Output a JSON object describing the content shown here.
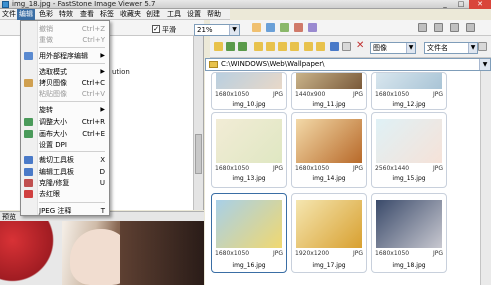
{
  "window": {
    "title": "img_18.jpg - FastStone Image Viewer 5.7",
    "min": "_",
    "max": "□",
    "close": "✕"
  },
  "menubar": [
    "文件",
    "编辑",
    "色彩",
    "特效",
    "查看",
    "标签",
    "收藏夹",
    "创建",
    "工具",
    "设置",
    "帮助"
  ],
  "edit_menu": {
    "items": [
      {
        "label": "撤销",
        "shortcut": "Ctrl+Z",
        "disabled": true
      },
      {
        "label": "重做",
        "shortcut": "Ctrl+Y",
        "disabled": true
      },
      {
        "label": "用外部程序编辑",
        "submenu": true
      },
      {
        "label": "选取模式",
        "submenu": true
      },
      {
        "label": "拷贝图像",
        "shortcut": "Ctrl+C"
      },
      {
        "label": "粘贴图像",
        "shortcut": "Ctrl+V",
        "disabled": true
      },
      {
        "label": "旋转",
        "submenu": true
      },
      {
        "label": "调整大小",
        "shortcut": "Ctrl+R"
      },
      {
        "label": "画布大小",
        "shortcut": "Ctrl+E"
      },
      {
        "label": "设置 DPI"
      },
      {
        "label": "裁切工具板",
        "shortcut": "X"
      },
      {
        "label": "编辑工具板",
        "shortcut": "D"
      },
      {
        "label": "克隆/修复",
        "shortcut": "U"
      },
      {
        "label": "去红眼"
      },
      {
        "label": "JPEG 注释",
        "shortcut": "T"
      }
    ]
  },
  "left_panel": {
    "partial_text": "ution",
    "preview_label": "预览"
  },
  "toolbar": {
    "smooth_label": "平滑",
    "zoom_value": "21%",
    "view_value": "图像",
    "sort_value": "文件名"
  },
  "path": "C:\\WINDOWS\\Web\\Wallpaper\\",
  "thumbnails": [
    {
      "dims": "1680x1050",
      "format": "JPG",
      "name": "img_10.jpg",
      "color1": "#b9cfe0",
      "color2": "#e8d8c8"
    },
    {
      "dims": "1440x900",
      "format": "JPG",
      "name": "img_11.jpg",
      "color1": "#c9b38a",
      "color2": "#7a5a3a"
    },
    {
      "dims": "1680x1050",
      "format": "JPG",
      "name": "img_12.jpg",
      "color1": "#d8e6ee",
      "color2": "#a9c4d6"
    },
    {
      "dims": "1680x1050",
      "format": "JPG",
      "name": "img_13.jpg",
      "color1": "#f2ecd6",
      "color2": "#dfe7c2"
    },
    {
      "dims": "1680x1050",
      "format": "JPG",
      "name": "img_14.jpg",
      "color1": "#f3d9a8",
      "color2": "#b86a2a"
    },
    {
      "dims": "2560x1440",
      "format": "JPG",
      "name": "img_15.jpg",
      "color1": "#dff1f6",
      "color2": "#f6e2d8"
    },
    {
      "dims": "1680x1050",
      "format": "JPG",
      "name": "img_16.jpg",
      "color1": "#a8d0e8",
      "color2": "#f0d870"
    },
    {
      "dims": "1920x1200",
      "format": "JPG",
      "name": "img_17.jpg",
      "color1": "#f5e6b0",
      "color2": "#d8a030"
    },
    {
      "dims": "1680x1050",
      "format": "JPG",
      "name": "img_18.jpg",
      "color1": "#3a4a6a",
      "color2": "#c8c8d0"
    }
  ]
}
